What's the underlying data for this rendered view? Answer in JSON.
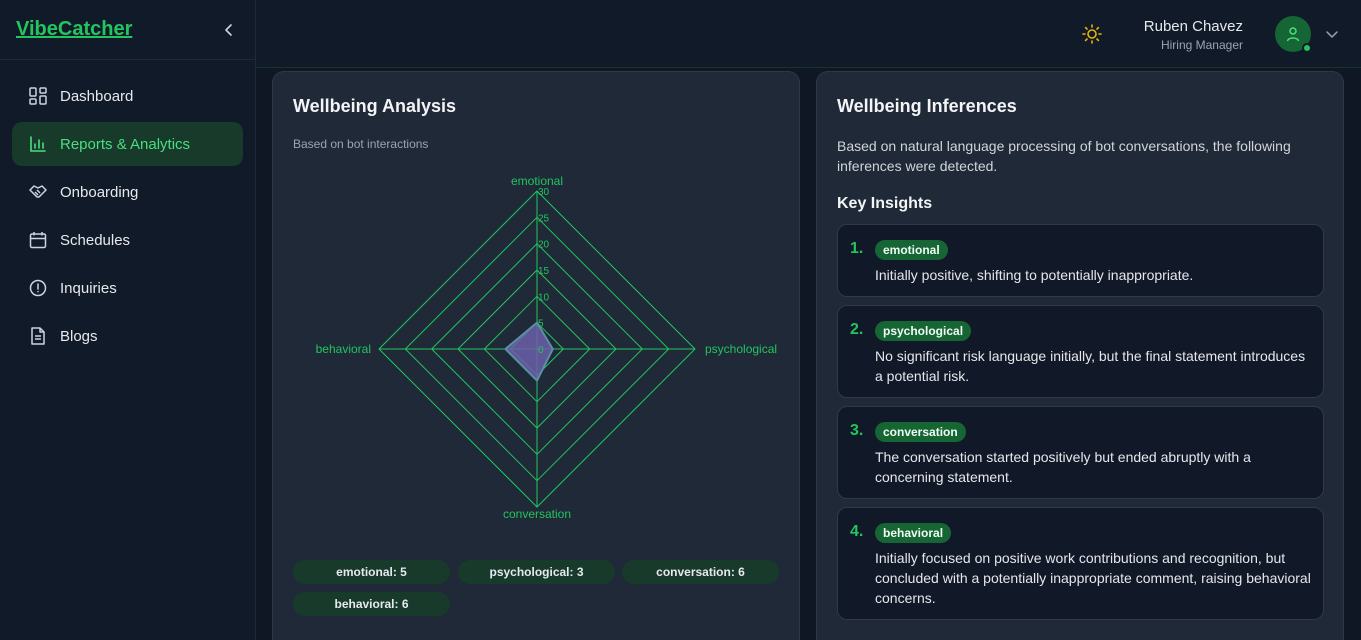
{
  "brand": "VibeCatcher",
  "sidebar": {
    "items": [
      {
        "label": "Dashboard",
        "icon": "dashboard-icon"
      },
      {
        "label": "Reports & Analytics",
        "icon": "bar-chart-icon",
        "active": true
      },
      {
        "label": "Onboarding",
        "icon": "handshake-icon"
      },
      {
        "label": "Schedules",
        "icon": "calendar-icon"
      },
      {
        "label": "Inquiries",
        "icon": "alert-circle-icon"
      },
      {
        "label": "Blogs",
        "icon": "document-icon"
      }
    ]
  },
  "header": {
    "user_name": "Ruben Chavez",
    "user_role": "Hiring Manager"
  },
  "analysis": {
    "title": "Wellbeing Analysis",
    "subtitle": "Based on bot interactions",
    "pills": [
      "emotional: 5",
      "psychological: 3",
      "conversation: 6",
      "behavioral: 6"
    ]
  },
  "chart_data": {
    "type": "radar",
    "axes": [
      "emotional",
      "psychological",
      "conversation",
      "behavioral"
    ],
    "values": [
      5,
      3,
      6,
      6
    ],
    "ticks": [
      0,
      5,
      10,
      15,
      20,
      25,
      30
    ],
    "rlim": [
      0,
      30
    ]
  },
  "inferences": {
    "title": "Wellbeing Inferences",
    "intro": "Based on natural language processing of bot conversations, the following inferences were detected.",
    "key_title": "Key Insights",
    "items": [
      {
        "num": "1.",
        "tag": "emotional",
        "text": "Initially positive, shifting to potentially inappropriate."
      },
      {
        "num": "2.",
        "tag": "psychological",
        "text": "No significant risk language initially, but the final statement introduces a potential risk."
      },
      {
        "num": "3.",
        "tag": "conversation",
        "text": "The conversation started positively but ended abruptly with a concerning statement."
      },
      {
        "num": "4.",
        "tag": "behavioral",
        "text": "Initially focused on positive work contributions and recognition, but concluded with a potentially inappropriate comment, raising behavioral concerns."
      }
    ]
  },
  "colors": {
    "accent": "#22c55e",
    "radar_fill": "#6b5fa8"
  }
}
